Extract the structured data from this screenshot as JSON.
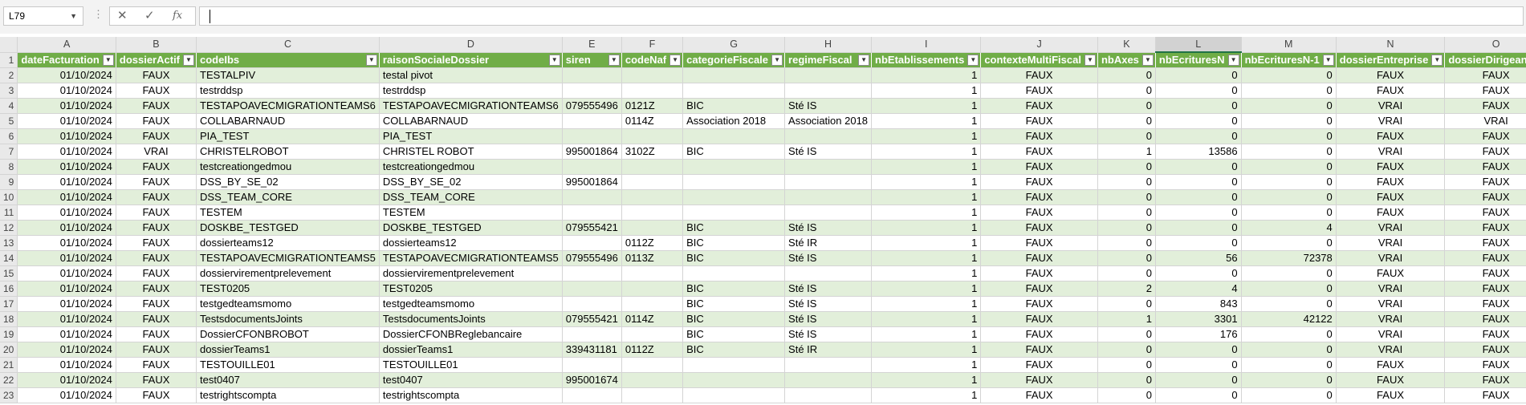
{
  "formula_bar": {
    "name_box": "L79",
    "cancel_icon": "✕",
    "enter_icon": "✓",
    "fx_icon": "fx",
    "formula_value": ""
  },
  "sheet": {
    "header_band_color": "#70ad47",
    "row_band_color": "#e2efda",
    "selected_column": "L",
    "column_letters": [
      "A",
      "B",
      "C",
      "D",
      "E",
      "F",
      "G",
      "H",
      "I",
      "J",
      "K",
      "L",
      "M",
      "N",
      "O"
    ],
    "headers": [
      "dateFacturation",
      "dossierActif",
      "codeIbs",
      "raisonSocialeDossier",
      "siren",
      "codeNaf",
      "categorieFiscale",
      "regimeFiscal",
      "nbEtablissements",
      "contexteMultiFiscal",
      "nbAxes",
      "nbEcrituresN",
      "nbEcrituresN-1",
      "dossierEntreprise",
      "dossierDirigeant"
    ],
    "rows": [
      {
        "row": "2",
        "cells": [
          "01/10/2024",
          "FAUX",
          "TESTALPIV",
          "testal pivot",
          "",
          "",
          "",
          "",
          "1",
          "FAUX",
          "0",
          "0",
          "0",
          "FAUX",
          "FAUX"
        ]
      },
      {
        "row": "3",
        "cells": [
          "01/10/2024",
          "FAUX",
          "testrddsp",
          "testrddsp",
          "",
          "",
          "",
          "",
          "1",
          "FAUX",
          "0",
          "0",
          "0",
          "FAUX",
          "FAUX"
        ]
      },
      {
        "row": "4",
        "cells": [
          "01/10/2024",
          "FAUX",
          "TESTAPOAVECMIGRATIONTEAMS6",
          "TESTAPOAVECMIGRATIONTEAMS6",
          "079555496",
          "0121Z",
          "BIC",
          "Sté IS",
          "1",
          "FAUX",
          "0",
          "0",
          "0",
          "VRAI",
          "FAUX"
        ]
      },
      {
        "row": "5",
        "cells": [
          "01/10/2024",
          "FAUX",
          "COLLABARNAUD",
          "COLLABARNAUD",
          "",
          "0114Z",
          "Association 2018",
          "Association 2018",
          "1",
          "FAUX",
          "0",
          "0",
          "0",
          "VRAI",
          "VRAI"
        ]
      },
      {
        "row": "6",
        "cells": [
          "01/10/2024",
          "FAUX",
          "PIA_TEST",
          "PIA_TEST",
          "",
          "",
          "",
          "",
          "1",
          "FAUX",
          "0",
          "0",
          "0",
          "FAUX",
          "FAUX"
        ]
      },
      {
        "row": "7",
        "cells": [
          "01/10/2024",
          "VRAI",
          "CHRISTELROBOT",
          "CHRISTEL ROBOT",
          "995001864",
          "3102Z",
          "BIC",
          "Sté IS",
          "1",
          "FAUX",
          "1",
          "13586",
          "0",
          "VRAI",
          "FAUX"
        ]
      },
      {
        "row": "8",
        "cells": [
          "01/10/2024",
          "FAUX",
          "testcreationgedmou",
          "testcreationgedmou",
          "",
          "",
          "",
          "",
          "1",
          "FAUX",
          "0",
          "0",
          "0",
          "FAUX",
          "FAUX"
        ]
      },
      {
        "row": "9",
        "cells": [
          "01/10/2024",
          "FAUX",
          "DSS_BY_SE_02",
          "DSS_BY_SE_02",
          "995001864",
          "",
          "",
          "",
          "1",
          "FAUX",
          "0",
          "0",
          "0",
          "FAUX",
          "FAUX"
        ]
      },
      {
        "row": "10",
        "cells": [
          "01/10/2024",
          "FAUX",
          "DSS_TEAM_CORE",
          "DSS_TEAM_CORE",
          "",
          "",
          "",
          "",
          "1",
          "FAUX",
          "0",
          "0",
          "0",
          "FAUX",
          "FAUX"
        ]
      },
      {
        "row": "11",
        "cells": [
          "01/10/2024",
          "FAUX",
          "TESTEM",
          "TESTEM",
          "",
          "",
          "",
          "",
          "1",
          "FAUX",
          "0",
          "0",
          "0",
          "FAUX",
          "FAUX"
        ]
      },
      {
        "row": "12",
        "cells": [
          "01/10/2024",
          "FAUX",
          "DOSKBE_TESTGED",
          "DOSKBE_TESTGED",
          "079555421",
          "",
          "BIC",
          "Sté IS",
          "1",
          "FAUX",
          "0",
          "0",
          "4",
          "VRAI",
          "FAUX"
        ]
      },
      {
        "row": "13",
        "cells": [
          "01/10/2024",
          "FAUX",
          "dossierteams12",
          "dossierteams12",
          "",
          "0112Z",
          "BIC",
          "Sté IR",
          "1",
          "FAUX",
          "0",
          "0",
          "0",
          "VRAI",
          "FAUX"
        ]
      },
      {
        "row": "14",
        "cells": [
          "01/10/2024",
          "FAUX",
          "TESTAPOAVECMIGRATIONTEAMS5",
          "TESTAPOAVECMIGRATIONTEAMS5",
          "079555496",
          "0113Z",
          "BIC",
          "Sté IS",
          "1",
          "FAUX",
          "0",
          "56",
          "72378",
          "VRAI",
          "FAUX"
        ]
      },
      {
        "row": "15",
        "cells": [
          "01/10/2024",
          "FAUX",
          "dossiervirementprelevement",
          "dossiervirementprelevement",
          "",
          "",
          "",
          "",
          "1",
          "FAUX",
          "0",
          "0",
          "0",
          "FAUX",
          "FAUX"
        ]
      },
      {
        "row": "16",
        "cells": [
          "01/10/2024",
          "FAUX",
          "TEST0205",
          "TEST0205",
          "",
          "",
          "BIC",
          "Sté IS",
          "1",
          "FAUX",
          "2",
          "4",
          "0",
          "VRAI",
          "FAUX"
        ]
      },
      {
        "row": "17",
        "cells": [
          "01/10/2024",
          "FAUX",
          "testgedteamsmomo",
          "testgedteamsmomo",
          "",
          "",
          "BIC",
          "Sté IS",
          "1",
          "FAUX",
          "0",
          "843",
          "0",
          "VRAI",
          "FAUX"
        ]
      },
      {
        "row": "18",
        "cells": [
          "01/10/2024",
          "FAUX",
          "TestsdocumentsJoints",
          "TestsdocumentsJoints",
          "079555421",
          "0114Z",
          "BIC",
          "Sté IS",
          "1",
          "FAUX",
          "1",
          "3301",
          "42122",
          "VRAI",
          "FAUX"
        ]
      },
      {
        "row": "19",
        "cells": [
          "01/10/2024",
          "FAUX",
          "DossierCFONBROBOT",
          "DossierCFONBReglebancaire",
          "",
          "",
          "BIC",
          "Sté IS",
          "1",
          "FAUX",
          "0",
          "176",
          "0",
          "VRAI",
          "FAUX"
        ]
      },
      {
        "row": "20",
        "cells": [
          "01/10/2024",
          "FAUX",
          "dossierTeams1",
          "dossierTeams1",
          "339431181",
          "0112Z",
          "BIC",
          "Sté IR",
          "1",
          "FAUX",
          "0",
          "0",
          "0",
          "VRAI",
          "FAUX"
        ]
      },
      {
        "row": "21",
        "cells": [
          "01/10/2024",
          "FAUX",
          "TESTOUILLE01",
          "TESTOUILLE01",
          "",
          "",
          "",
          "",
          "1",
          "FAUX",
          "0",
          "0",
          "0",
          "FAUX",
          "FAUX"
        ]
      },
      {
        "row": "22",
        "cells": [
          "01/10/2024",
          "FAUX",
          "test0407",
          "test0407",
          "995001674",
          "",
          "",
          "",
          "1",
          "FAUX",
          "0",
          "0",
          "0",
          "FAUX",
          "FAUX"
        ]
      },
      {
        "row": "23",
        "cells": [
          "01/10/2024",
          "FAUX",
          "testrightscompta",
          "testrightscompta",
          "",
          "",
          "",
          "",
          "1",
          "FAUX",
          "0",
          "0",
          "0",
          "FAUX",
          "FAUX"
        ]
      }
    ]
  }
}
